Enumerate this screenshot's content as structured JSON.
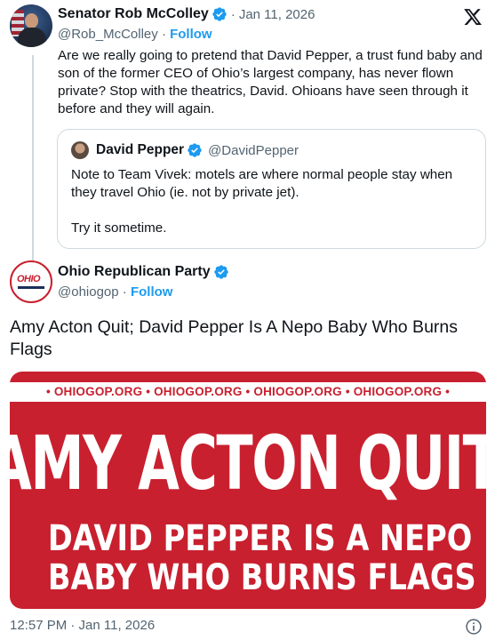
{
  "tweet": {
    "author_name": "Senator Rob McColley",
    "verified": true,
    "date": "Jan 11, 2026",
    "handle": "@Rob_McColley",
    "follow_label": "Follow",
    "text": "Are we really going to pretend that David Pepper, a trust fund baby and son of the former CEO of Ohio’s largest company, has never flown private? Stop with the theatrics, David. Ohioans have seen through it before and they will again.",
    "platform_icon": "x-logo-icon"
  },
  "quoted": {
    "author_name": "David Pepper",
    "verified": true,
    "handle": "@DavidPepper",
    "text": "Note to Team Vivek: motels are where normal people stay when they travel Ohio (ie. not by private jet).\n\nTry it sometime."
  },
  "reply": {
    "author_name": "Ohio Republican Party",
    "verified": true,
    "handle": "@ohiogop",
    "follow_label": "Follow",
    "avatar_text": "OHIO",
    "headline": "Amy Acton Quit; David Pepper Is A Nepo Baby Who Burns Flags",
    "graphic": {
      "strip": "• OHIOGOP.ORG • OHIOGOP.ORG • OHIOGOP.ORG • OHIOGOP.ORG •",
      "line1": "AMY ACTON QUIT",
      "line2": "DAVID PEPPER IS A NEPO",
      "line3": "BABY WHO BURNS FLAGS",
      "background_color": "#c8202f"
    },
    "timestamp": "12:57 PM · Jan 11, 2026"
  },
  "colors": {
    "accent": "#1d9bf0",
    "secondary_text": "#536471",
    "border": "#cfd9de"
  }
}
